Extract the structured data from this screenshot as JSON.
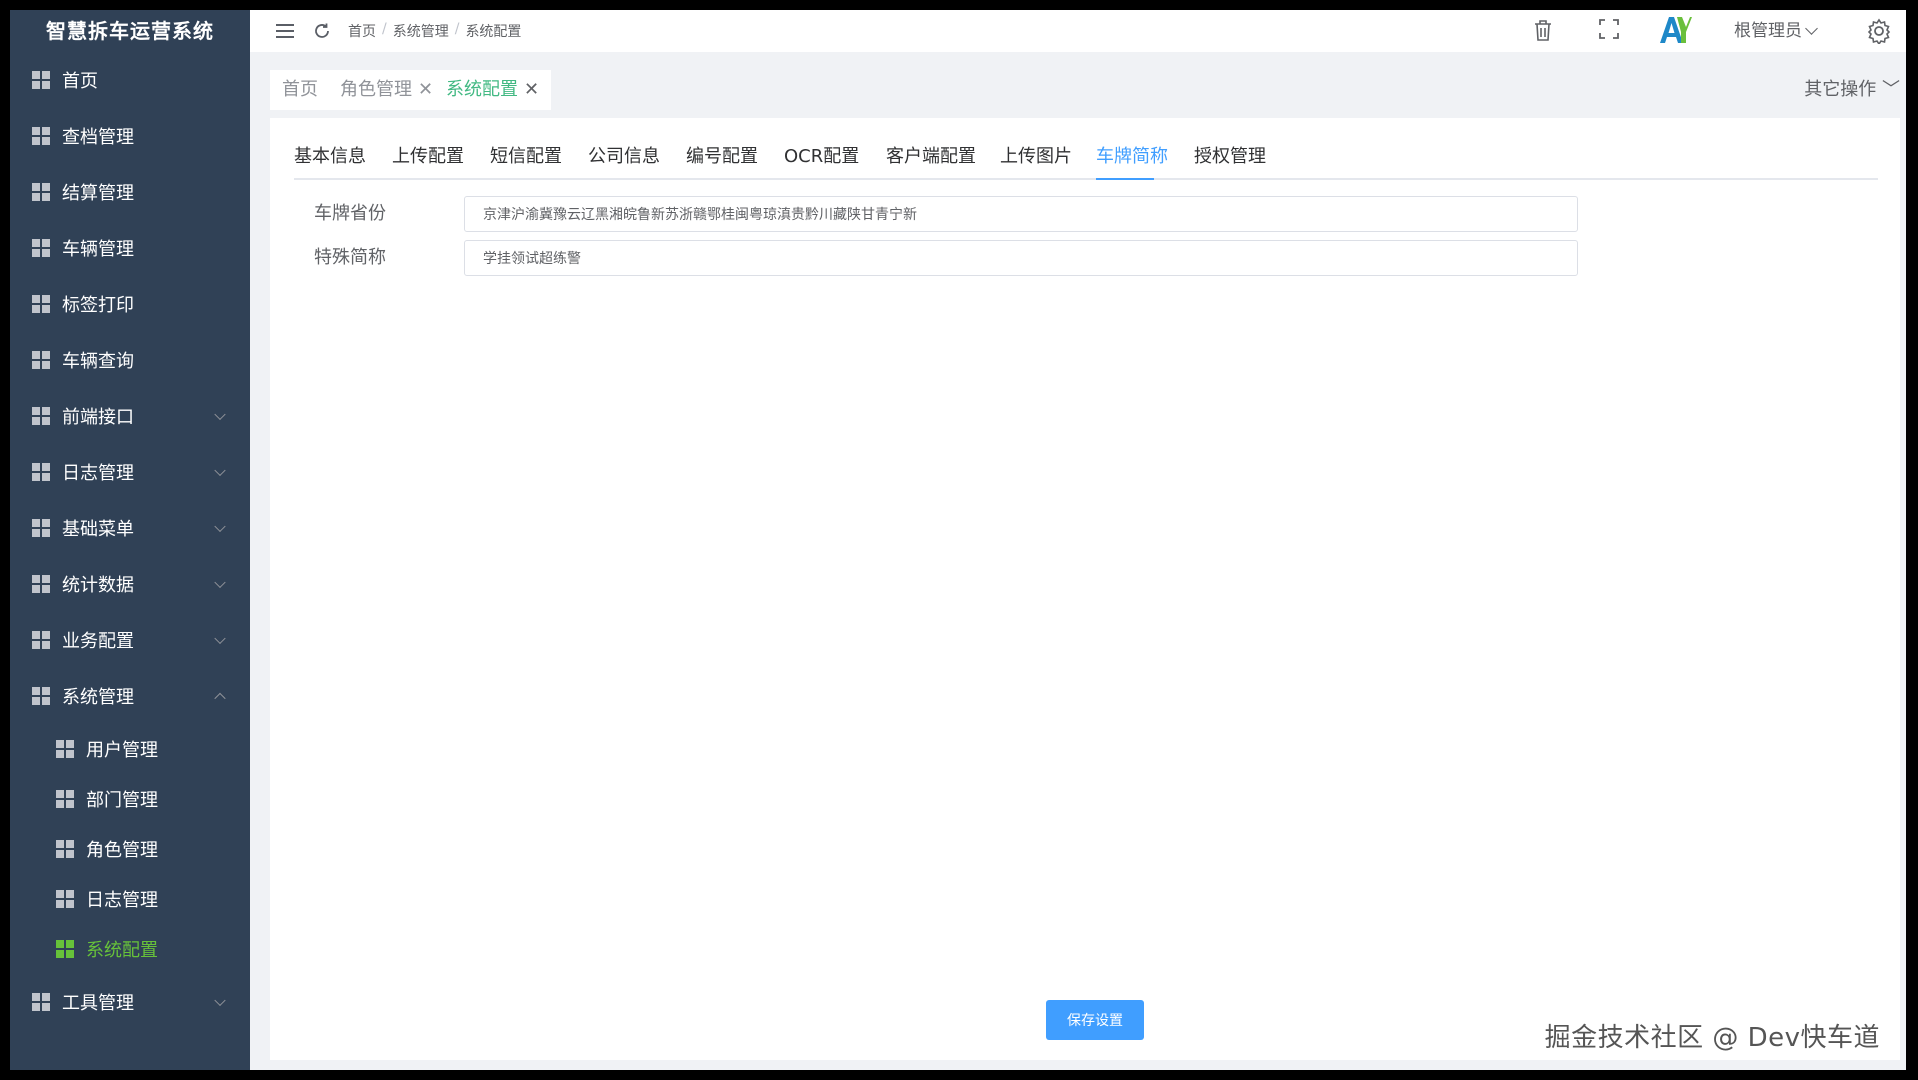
{
  "sidebar": {
    "title": "智慧拆车运营系统",
    "items": [
      {
        "label": "首页"
      },
      {
        "label": "查档管理"
      },
      {
        "label": "结算管理"
      },
      {
        "label": "车辆管理"
      },
      {
        "label": "标签打印"
      },
      {
        "label": "车辆查询"
      },
      {
        "label": "前端接口"
      },
      {
        "label": "日志管理"
      },
      {
        "label": "基础菜单"
      },
      {
        "label": "统计数据"
      },
      {
        "label": "业务配置"
      },
      {
        "label": "系统管理"
      },
      {
        "label": "工具管理"
      }
    ],
    "sub_items": [
      {
        "label": "用户管理"
      },
      {
        "label": "部门管理"
      },
      {
        "label": "角色管理"
      },
      {
        "label": "日志管理"
      },
      {
        "label": "系统配置"
      }
    ]
  },
  "header": {
    "breadcrumb": [
      "首页",
      "系统管理",
      "系统配置"
    ],
    "user_name": "根管理员",
    "icons": [
      "menu-fold-icon",
      "refresh-icon",
      "trash-icon",
      "fullscreen-icon",
      "logo-icon",
      "settings-icon"
    ]
  },
  "tags": {
    "items": [
      {
        "label": "首页"
      },
      {
        "label": "角色管理"
      },
      {
        "label": "系统配置"
      }
    ],
    "other_ops": "其它操作"
  },
  "tabs": [
    {
      "label": "基本信息"
    },
    {
      "label": "上传配置"
    },
    {
      "label": "短信配置"
    },
    {
      "label": "公司信息"
    },
    {
      "label": "编号配置"
    },
    {
      "label": "OCR配置"
    },
    {
      "label": "客户端配置"
    },
    {
      "label": "上传图片"
    },
    {
      "label": "车牌简称"
    },
    {
      "label": "授权管理"
    }
  ],
  "form": {
    "province_label": "车牌省份",
    "province_value": "京津沪渝冀豫云辽黑湘皖鲁新苏浙赣鄂桂闽粤琼滇贵黔川藏陕甘青宁新",
    "special_label": "特殊简称",
    "special_value": "学挂领试超练警"
  },
  "save_button": "保存设置",
  "watermark": "掘金技术社区 @ Dev快车道",
  "colors": {
    "sidebar_bg": "#304156",
    "active_green": "#67c23a",
    "tag_active": "#42b983",
    "primary": "#409eff"
  }
}
